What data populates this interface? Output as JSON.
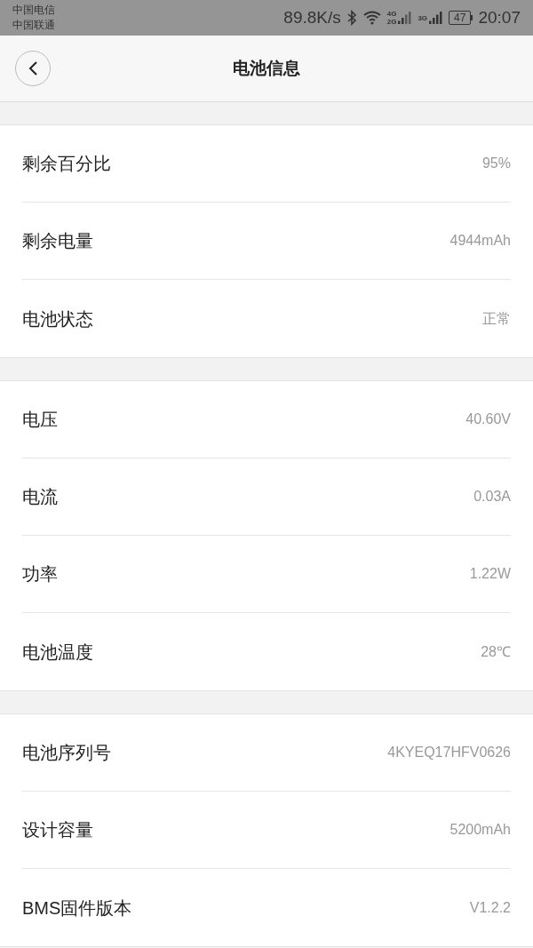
{
  "status_bar": {
    "carriers": [
      "中国电信",
      "中国联通"
    ],
    "speed": "89.8K/s",
    "signals": [
      {
        "labels": [
          "4G",
          "2G"
        ]
      },
      {
        "labels": [
          "3G"
        ]
      }
    ],
    "battery": "47",
    "time": "20:07"
  },
  "header": {
    "title": "电池信息"
  },
  "sections": [
    {
      "rows": [
        {
          "label": "剩余百分比",
          "value": "95%"
        },
        {
          "label": "剩余电量",
          "value": "4944mAh"
        },
        {
          "label": "电池状态",
          "value": "正常"
        }
      ]
    },
    {
      "rows": [
        {
          "label": "电压",
          "value": "40.60V"
        },
        {
          "label": "电流",
          "value": "0.03A"
        },
        {
          "label": "功率",
          "value": "1.22W"
        },
        {
          "label": "电池温度",
          "value": "28℃"
        }
      ]
    },
    {
      "rows": [
        {
          "label": "电池序列号",
          "value": "4KYEQ17HFV0626"
        },
        {
          "label": "设计容量",
          "value": "5200mAh"
        },
        {
          "label": "BMS固件版本",
          "value": "V1.2.2"
        }
      ]
    }
  ]
}
